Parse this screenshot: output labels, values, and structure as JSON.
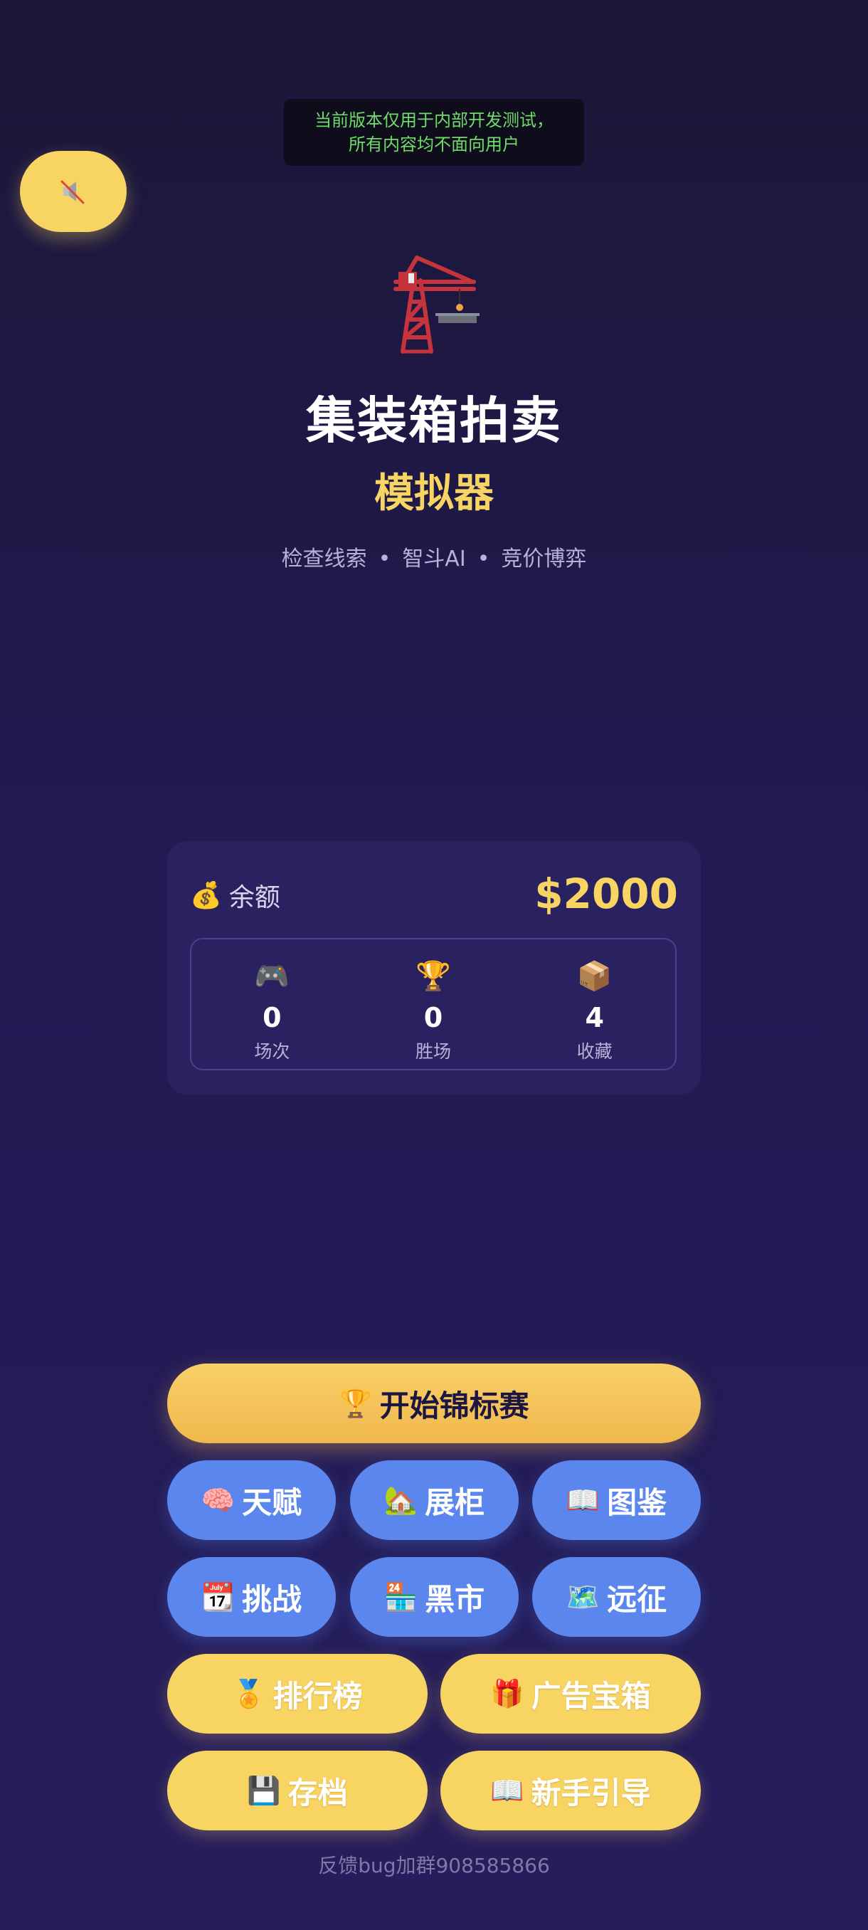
{
  "notice": {
    "line1": "当前版本仅用于内部开发测试，",
    "line2": "所有内容均不面向用户"
  },
  "header": {
    "title": "集装箱拍卖",
    "subtitle": "模拟器"
  },
  "tagline": {
    "items": [
      "检查线索",
      "智斗AI",
      "竞价博弈"
    ],
    "separator": "•"
  },
  "balance": {
    "icon": "💰",
    "label": "余额",
    "value": "$2000"
  },
  "stats": [
    {
      "icon": "🎮",
      "value": "0",
      "label": "场次"
    },
    {
      "icon": "🏆",
      "value": "0",
      "label": "胜场"
    },
    {
      "icon": "📦",
      "value": "4",
      "label": "收藏"
    }
  ],
  "buttons": {
    "start": {
      "icon": "🏆",
      "label": "开始锦标赛"
    },
    "talent": {
      "icon": "🧠",
      "label": "天赋"
    },
    "showcase": {
      "icon": "🏡",
      "label": "展柜"
    },
    "codex": {
      "icon": "📖",
      "label": "图鉴"
    },
    "challenge": {
      "icon": "📆",
      "label": "挑战"
    },
    "black_market": {
      "icon": "🏪",
      "label": "黑市"
    },
    "expedition": {
      "icon": "🗺️",
      "label": "远征"
    },
    "leaderboard": {
      "icon": "🏅",
      "label": "排行榜"
    },
    "ad_chest": {
      "icon": "🎁",
      "label": "广告宝箱"
    },
    "save": {
      "icon": "💾",
      "label": "存档"
    },
    "tutorial": {
      "icon": "📖",
      "label": "新手引导"
    }
  },
  "footer": {
    "feedback": "反馈bug加群908585866"
  },
  "colors": {
    "accent": "#f8d463",
    "primary_button": "#5b86ee",
    "background": "#221a52",
    "notice_text": "#6fdc6a"
  }
}
